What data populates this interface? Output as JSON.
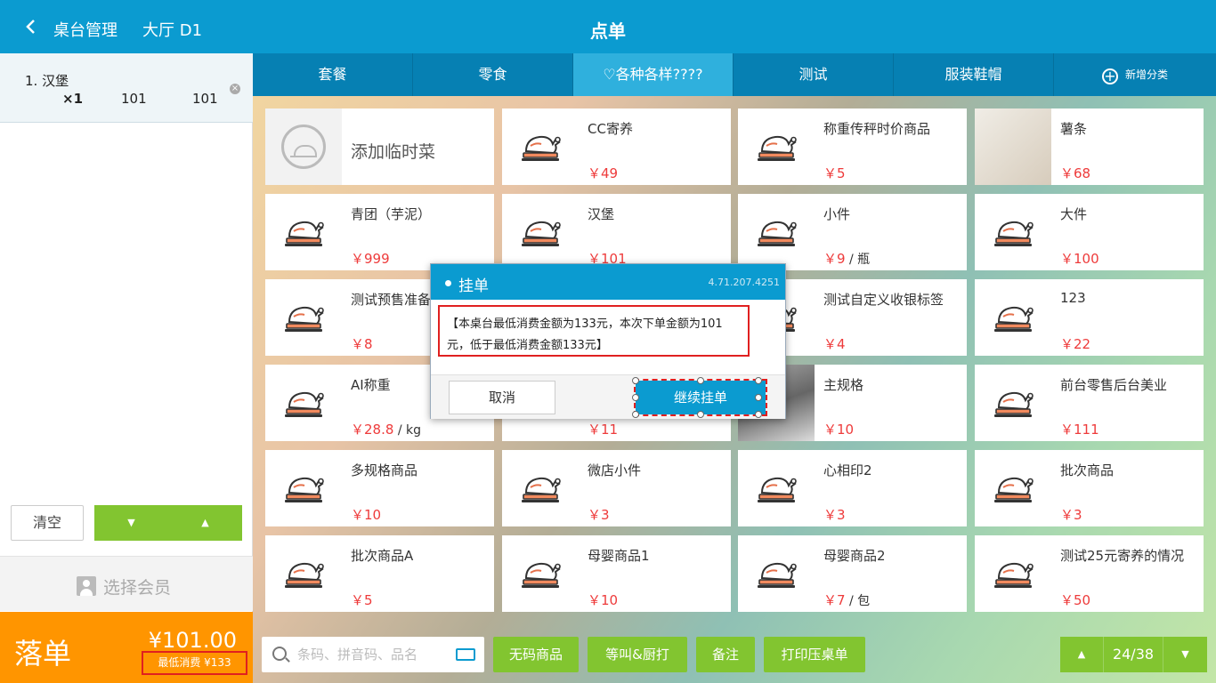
{
  "header": {
    "back_label": "桌台管理",
    "table_label": "大厅 D1",
    "title": "点单"
  },
  "order": {
    "item_name": "1. 汉堡",
    "qty": "×1",
    "unit_price": "101",
    "line_total": "101",
    "remove_icon": "×"
  },
  "left_actions": {
    "clear_label": "清空",
    "down_icon": "▼",
    "up_icon": "▲",
    "member_label": "选择会员"
  },
  "checkout": {
    "label": "落单",
    "total": "¥101.00",
    "min_spend": "最低消费 ¥133"
  },
  "tabs": [
    {
      "label": "套餐"
    },
    {
      "label": "零食"
    },
    {
      "label": "♡各种各样????"
    },
    {
      "label": "测试"
    },
    {
      "label": "服装鞋帽"
    }
  ],
  "add_category": {
    "icon": "+",
    "label": "新增分类"
  },
  "products": [
    {
      "name": "添加临时菜",
      "price": "",
      "unit": "",
      "thumb": "plus"
    },
    {
      "name": "CC寄养",
      "price": "￥49",
      "unit": "",
      "thumb": "chicken"
    },
    {
      "name": "称重传秤时价商品",
      "price": "￥5",
      "unit": "",
      "thumb": "chicken"
    },
    {
      "name": "薯条",
      "price": "￥68",
      "unit": "",
      "thumb": "photo"
    },
    {
      "name": "青团（芋泥）",
      "price": "￥999",
      "unit": "",
      "thumb": "chicken"
    },
    {
      "name": "汉堡",
      "price": "￥101",
      "unit": "",
      "thumb": "chicken"
    },
    {
      "name": "小件",
      "price": "￥9",
      "unit": " / 瓶",
      "thumb": "chicken"
    },
    {
      "name": "大件",
      "price": "￥100",
      "unit": "",
      "thumb": "chicken"
    },
    {
      "name": "测试预售准备",
      "price": "￥8",
      "unit": "",
      "thumb": "chicken"
    },
    {
      "name": "",
      "price": "",
      "unit": "",
      "thumb": "chicken"
    },
    {
      "name": "测试自定义收银标签",
      "price": "￥4",
      "unit": "",
      "thumb": "chicken"
    },
    {
      "name": "123",
      "price": "￥22",
      "unit": "",
      "thumb": "chicken"
    },
    {
      "name": "AI称重",
      "price": "￥28.8",
      "unit": " / kg",
      "thumb": "chicken"
    },
    {
      "name": "",
      "price": "￥11",
      "unit": "",
      "thumb": "chicken"
    },
    {
      "name": "主规格",
      "price": "￥10",
      "unit": "",
      "thumb": "photo2"
    },
    {
      "name": "前台零售后台美业",
      "price": "￥111",
      "unit": "",
      "thumb": "chicken"
    },
    {
      "name": "多规格商品",
      "price": "￥10",
      "unit": "",
      "thumb": "chicken"
    },
    {
      "name": "微店小件",
      "price": "￥3",
      "unit": "",
      "thumb": "chicken"
    },
    {
      "name": "心相印2",
      "price": "￥3",
      "unit": "",
      "thumb": "chicken"
    },
    {
      "name": "批次商品",
      "price": "￥3",
      "unit": "",
      "thumb": "chicken"
    },
    {
      "name": "批次商品A",
      "price": "￥5",
      "unit": "",
      "thumb": "chicken"
    },
    {
      "name": "母婴商品1",
      "price": "￥10",
      "unit": "",
      "thumb": "chicken"
    },
    {
      "name": "母婴商品2",
      "price": "￥7",
      "unit": " / 包",
      "thumb": "chicken"
    },
    {
      "name": "测试25元寄养的情况",
      "price": "￥50",
      "unit": "",
      "thumb": "chicken"
    }
  ],
  "bottom": {
    "search_placeholder": "条码、拼音码、品名",
    "btn_nocode": "无码商品",
    "btn_wait": "等叫&厨打",
    "btn_note": "备注",
    "btn_print": "打印压桌单",
    "page_up": "▲",
    "page_down": "▼",
    "page_indicator": "24/38"
  },
  "dialog": {
    "title": "挂单",
    "version": "4.71.207.4251",
    "message": "【本桌台最低消费金额为133元，本次下单金额为101元，低于最低消费金额133元】",
    "cancel_label": "取消",
    "confirm_label": "继续挂单"
  },
  "colors": {
    "primary": "#0b9bd0",
    "green": "#82c530",
    "orange": "#ff9500",
    "price": "#ee3b3b"
  }
}
